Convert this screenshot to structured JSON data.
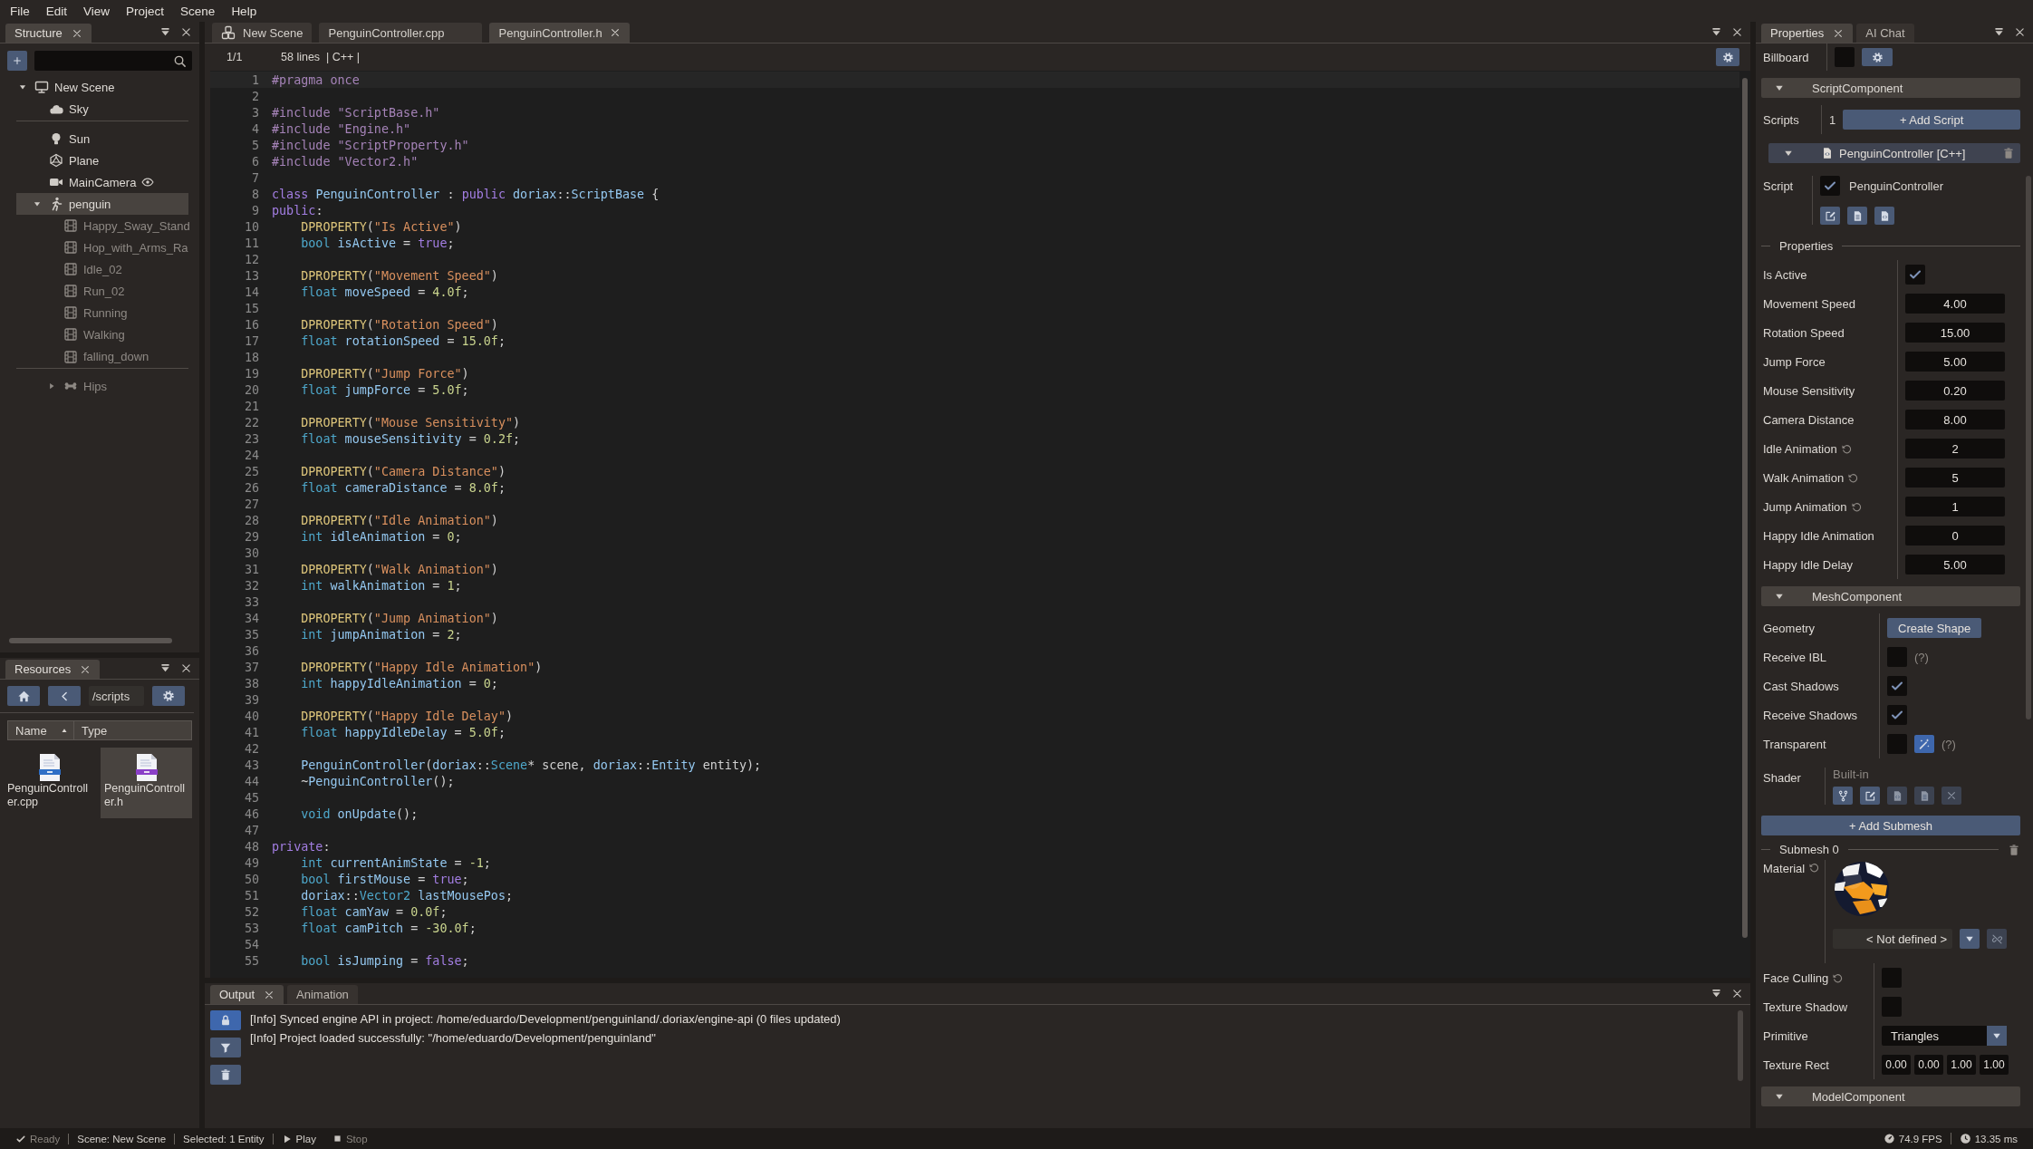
{
  "menu": [
    "File",
    "Edit",
    "View",
    "Project",
    "Scene",
    "Help"
  ],
  "structure": {
    "tabs": [
      {
        "label": "Structure",
        "selected": true
      }
    ],
    "tree": [
      {
        "label": "New Scene",
        "kind": "scene",
        "expanded": true,
        "selected": false,
        "divider_after": false,
        "children": [
          {
            "label": "Sky",
            "kind": "sky",
            "selected": false,
            "divider_after": true
          },
          {
            "label": "Sun",
            "kind": "light",
            "selected": false,
            "divider_after": false
          },
          {
            "label": "Plane",
            "kind": "mesh",
            "selected": false,
            "divider_after": false
          },
          {
            "label": "MainCamera",
            "kind": "camera",
            "selected": false,
            "divider_after": false
          },
          {
            "label": "penguin",
            "kind": "model",
            "expanded": true,
            "selected": true,
            "divider_after": false,
            "children": [
              {
                "label": "Happy_Sway_Stand",
                "kind": "animation",
                "selected": false,
                "divider_after": false
              },
              {
                "label": "Hop_with_Arms_Ra",
                "kind": "animation",
                "selected": false,
                "divider_after": false
              },
              {
                "label": "Idle_02",
                "kind": "animation",
                "selected": false,
                "divider_after": false
              },
              {
                "label": "Run_02",
                "kind": "animation",
                "selected": false,
                "divider_after": false
              },
              {
                "label": "Running",
                "kind": "animation",
                "selected": false,
                "divider_after": false
              },
              {
                "label": "Walking",
                "kind": "animation",
                "selected": false,
                "divider_after": false
              },
              {
                "label": "falling_down",
                "kind": "animation",
                "selected": false,
                "divider_after": true
              },
              {
                "label": "Hips",
                "kind": "bone",
                "expanded": false,
                "selected": false,
                "divider_after": false
              }
            ]
          }
        ]
      }
    ]
  },
  "resources": {
    "tabs": [
      {
        "label": "Resources",
        "selected": true
      }
    ],
    "path": "/scripts",
    "columns": [
      {
        "label": "Name",
        "sorted": true
      },
      {
        "label": "Type",
        "sorted": false
      }
    ],
    "files": [
      {
        "name": "PenguinController.cpp",
        "kind": "cpp",
        "selected": false
      },
      {
        "name": "PenguinController.h",
        "kind": "h",
        "selected": true
      }
    ]
  },
  "editor": {
    "tabs": [
      {
        "label": "New Scene",
        "kind": "scene",
        "selected": false
      },
      {
        "label": "PenguinController.cpp",
        "kind": "file",
        "selected": false
      },
      {
        "label": "PenguinController.h",
        "kind": "file",
        "selected": true
      }
    ],
    "position": "1/1",
    "info": "58 lines  | C++ |",
    "lines": [
      {
        "number": "1",
        "indent": false,
        "tokens": [
          {
            "kind": "pre",
            "text": "#pragma once"
          }
        ]
      },
      {
        "number": "2"
      },
      {
        "number": "3",
        "indent": false,
        "tokens": [
          {
            "kind": "pre",
            "text": "#include \"ScriptBase.h\""
          }
        ]
      },
      {
        "number": "4",
        "indent": false,
        "tokens": [
          {
            "kind": "pre",
            "text": "#include \"Engine.h\""
          }
        ]
      },
      {
        "number": "5",
        "indent": false,
        "tokens": [
          {
            "kind": "pre",
            "text": "#include \"ScriptProperty.h\""
          }
        ]
      },
      {
        "number": "6",
        "indent": false,
        "tokens": [
          {
            "kind": "pre",
            "text": "#include \"Vector2.h\""
          }
        ]
      },
      {
        "number": "7"
      },
      {
        "number": "8",
        "indent": false,
        "tokens": [
          {
            "kind": "kw",
            "text": "class "
          },
          {
            "kind": "id",
            "text": "PenguinController"
          },
          {
            "kind": "p",
            "text": " : "
          },
          {
            "kind": "kw",
            "text": "public "
          },
          {
            "kind": "id",
            "text": "doriax"
          },
          {
            "kind": "p",
            "text": "::"
          },
          {
            "kind": "id",
            "text": "ScriptBase"
          },
          {
            "kind": "p",
            "text": " {"
          }
        ]
      },
      {
        "number": "9",
        "indent": false,
        "tokens": [
          {
            "kind": "kw",
            "text": "public"
          },
          {
            "kind": "p",
            "text": ":"
          }
        ]
      },
      {
        "number": "10",
        "indent": true,
        "tokens": [
          {
            "kind": "fn",
            "text": "DPROPERTY"
          },
          {
            "kind": "p",
            "text": "("
          },
          {
            "kind": "str",
            "text": "\"Is Active\""
          },
          {
            "kind": "p",
            "text": ")"
          }
        ]
      },
      {
        "number": "11",
        "indent": true,
        "tokens": [
          {
            "kind": "type",
            "text": "bool "
          },
          {
            "kind": "id",
            "text": "isActive"
          },
          {
            "kind": "p",
            "text": " = "
          },
          {
            "kind": "kw",
            "text": "true"
          },
          {
            "kind": "p",
            "text": ";"
          }
        ]
      },
      {
        "number": "12"
      },
      {
        "number": "13",
        "indent": true,
        "tokens": [
          {
            "kind": "fn",
            "text": "DPROPERTY"
          },
          {
            "kind": "p",
            "text": "("
          },
          {
            "kind": "str",
            "text": "\"Movement Speed\""
          },
          {
            "kind": "p",
            "text": ")"
          }
        ]
      },
      {
        "number": "14",
        "indent": true,
        "tokens": [
          {
            "kind": "type",
            "text": "float "
          },
          {
            "kind": "id",
            "text": "moveSpeed"
          },
          {
            "kind": "p",
            "text": " = "
          },
          {
            "kind": "num",
            "text": "4.0f"
          },
          {
            "kind": "p",
            "text": ";"
          }
        ]
      },
      {
        "number": "15"
      },
      {
        "number": "16",
        "indent": true,
        "tokens": [
          {
            "kind": "fn",
            "text": "DPROPERTY"
          },
          {
            "kind": "p",
            "text": "("
          },
          {
            "kind": "str",
            "text": "\"Rotation Speed\""
          },
          {
            "kind": "p",
            "text": ")"
          }
        ]
      },
      {
        "number": "17",
        "indent": true,
        "tokens": [
          {
            "kind": "type",
            "text": "float "
          },
          {
            "kind": "id",
            "text": "rotationSpeed"
          },
          {
            "kind": "p",
            "text": " = "
          },
          {
            "kind": "num",
            "text": "15.0f"
          },
          {
            "kind": "p",
            "text": ";"
          }
        ]
      },
      {
        "number": "18"
      },
      {
        "number": "19",
        "indent": true,
        "tokens": [
          {
            "kind": "fn",
            "text": "DPROPERTY"
          },
          {
            "kind": "p",
            "text": "("
          },
          {
            "kind": "str",
            "text": "\"Jump Force\""
          },
          {
            "kind": "p",
            "text": ")"
          }
        ]
      },
      {
        "number": "20",
        "indent": true,
        "tokens": [
          {
            "kind": "type",
            "text": "float "
          },
          {
            "kind": "id",
            "text": "jumpForce"
          },
          {
            "kind": "p",
            "text": " = "
          },
          {
            "kind": "num",
            "text": "5.0f"
          },
          {
            "kind": "p",
            "text": ";"
          }
        ]
      },
      {
        "number": "21"
      },
      {
        "number": "22",
        "indent": true,
        "tokens": [
          {
            "kind": "fn",
            "text": "DPROPERTY"
          },
          {
            "kind": "p",
            "text": "("
          },
          {
            "kind": "str",
            "text": "\"Mouse Sensitivity\""
          },
          {
            "kind": "p",
            "text": ")"
          }
        ]
      },
      {
        "number": "23",
        "indent": true,
        "tokens": [
          {
            "kind": "type",
            "text": "float "
          },
          {
            "kind": "id",
            "text": "mouseSensitivity"
          },
          {
            "kind": "p",
            "text": " = "
          },
          {
            "kind": "num",
            "text": "0.2f"
          },
          {
            "kind": "p",
            "text": ";"
          }
        ]
      },
      {
        "number": "24"
      },
      {
        "number": "25",
        "indent": true,
        "tokens": [
          {
            "kind": "fn",
            "text": "DPROPERTY"
          },
          {
            "kind": "p",
            "text": "("
          },
          {
            "kind": "str",
            "text": "\"Camera Distance\""
          },
          {
            "kind": "p",
            "text": ")"
          }
        ]
      },
      {
        "number": "26",
        "indent": true,
        "tokens": [
          {
            "kind": "type",
            "text": "float "
          },
          {
            "kind": "id",
            "text": "cameraDistance"
          },
          {
            "kind": "p",
            "text": " = "
          },
          {
            "kind": "num",
            "text": "8.0f"
          },
          {
            "kind": "p",
            "text": ";"
          }
        ]
      },
      {
        "number": "27"
      },
      {
        "number": "28",
        "indent": true,
        "tokens": [
          {
            "kind": "fn",
            "text": "DPROPERTY"
          },
          {
            "kind": "p",
            "text": "("
          },
          {
            "kind": "str",
            "text": "\"Idle Animation\""
          },
          {
            "kind": "p",
            "text": ")"
          }
        ]
      },
      {
        "number": "29",
        "indent": true,
        "tokens": [
          {
            "kind": "type",
            "text": "int "
          },
          {
            "kind": "id",
            "text": "idleAnimation"
          },
          {
            "kind": "p",
            "text": " = "
          },
          {
            "kind": "num",
            "text": "0"
          },
          {
            "kind": "p",
            "text": ";"
          }
        ]
      },
      {
        "number": "30"
      },
      {
        "number": "31",
        "indent": true,
        "tokens": [
          {
            "kind": "fn",
            "text": "DPROPERTY"
          },
          {
            "kind": "p",
            "text": "("
          },
          {
            "kind": "str",
            "text": "\"Walk Animation\""
          },
          {
            "kind": "p",
            "text": ")"
          }
        ]
      },
      {
        "number": "32",
        "indent": true,
        "tokens": [
          {
            "kind": "type",
            "text": "int "
          },
          {
            "kind": "id",
            "text": "walkAnimation"
          },
          {
            "kind": "p",
            "text": " = "
          },
          {
            "kind": "num",
            "text": "1"
          },
          {
            "kind": "p",
            "text": ";"
          }
        ]
      },
      {
        "number": "33"
      },
      {
        "number": "34",
        "indent": true,
        "tokens": [
          {
            "kind": "fn",
            "text": "DPROPERTY"
          },
          {
            "kind": "p",
            "text": "("
          },
          {
            "kind": "str",
            "text": "\"Jump Animation\""
          },
          {
            "kind": "p",
            "text": ")"
          }
        ]
      },
      {
        "number": "35",
        "indent": true,
        "tokens": [
          {
            "kind": "type",
            "text": "int "
          },
          {
            "kind": "id",
            "text": "jumpAnimation"
          },
          {
            "kind": "p",
            "text": " = "
          },
          {
            "kind": "num",
            "text": "2"
          },
          {
            "kind": "p",
            "text": ";"
          }
        ]
      },
      {
        "number": "36"
      },
      {
        "number": "37",
        "indent": true,
        "tokens": [
          {
            "kind": "fn",
            "text": "DPROPERTY"
          },
          {
            "kind": "p",
            "text": "("
          },
          {
            "kind": "str",
            "text": "\"Happy Idle Animation\""
          },
          {
            "kind": "p",
            "text": ")"
          }
        ]
      },
      {
        "number": "38",
        "indent": true,
        "tokens": [
          {
            "kind": "type",
            "text": "int "
          },
          {
            "kind": "id",
            "text": "happyIdleAnimation"
          },
          {
            "kind": "p",
            "text": " = "
          },
          {
            "kind": "num",
            "text": "0"
          },
          {
            "kind": "p",
            "text": ";"
          }
        ]
      },
      {
        "number": "39"
      },
      {
        "number": "40",
        "indent": true,
        "tokens": [
          {
            "kind": "fn",
            "text": "DPROPERTY"
          },
          {
            "kind": "p",
            "text": "("
          },
          {
            "kind": "str",
            "text": "\"Happy Idle Delay\""
          },
          {
            "kind": "p",
            "text": ")"
          }
        ]
      },
      {
        "number": "41",
        "indent": true,
        "tokens": [
          {
            "kind": "type",
            "text": "float "
          },
          {
            "kind": "id",
            "text": "happyIdleDelay"
          },
          {
            "kind": "p",
            "text": " = "
          },
          {
            "kind": "num",
            "text": "5.0f"
          },
          {
            "kind": "p",
            "text": ";"
          }
        ]
      },
      {
        "number": "42"
      },
      {
        "number": "43",
        "indent": true,
        "tokens": [
          {
            "kind": "id",
            "text": "PenguinController"
          },
          {
            "kind": "p",
            "text": "("
          },
          {
            "kind": "id",
            "text": "doriax"
          },
          {
            "kind": "p",
            "text": "::"
          },
          {
            "kind": "type",
            "text": "Scene"
          },
          {
            "kind": "p",
            "text": "* scene, "
          },
          {
            "kind": "id",
            "text": "doriax"
          },
          {
            "kind": "p",
            "text": "::"
          },
          {
            "kind": "id",
            "text": "Entity"
          },
          {
            "kind": "p",
            "text": " entity);"
          }
        ]
      },
      {
        "number": "44",
        "indent": true,
        "tokens": [
          {
            "kind": "p",
            "text": "~"
          },
          {
            "kind": "id",
            "text": "PenguinController"
          },
          {
            "kind": "p",
            "text": "();"
          }
        ]
      },
      {
        "number": "45"
      },
      {
        "number": "46",
        "indent": true,
        "tokens": [
          {
            "kind": "type",
            "text": "void "
          },
          {
            "kind": "id",
            "text": "onUpdate"
          },
          {
            "kind": "p",
            "text": "();"
          }
        ]
      },
      {
        "number": "47"
      },
      {
        "number": "48",
        "indent": false,
        "tokens": [
          {
            "kind": "kw",
            "text": "private"
          },
          {
            "kind": "p",
            "text": ":"
          }
        ]
      },
      {
        "number": "49",
        "indent": true,
        "tokens": [
          {
            "kind": "type",
            "text": "int "
          },
          {
            "kind": "id",
            "text": "currentAnimState"
          },
          {
            "kind": "p",
            "text": " = "
          },
          {
            "kind": "num",
            "text": "-1"
          },
          {
            "kind": "p",
            "text": ";"
          }
        ]
      },
      {
        "number": "50",
        "indent": true,
        "tokens": [
          {
            "kind": "type",
            "text": "bool "
          },
          {
            "kind": "id",
            "text": "firstMouse"
          },
          {
            "kind": "p",
            "text": " = "
          },
          {
            "kind": "kw",
            "text": "true"
          },
          {
            "kind": "p",
            "text": ";"
          }
        ]
      },
      {
        "number": "51",
        "indent": true,
        "tokens": [
          {
            "kind": "id",
            "text": "doriax"
          },
          {
            "kind": "p",
            "text": "::"
          },
          {
            "kind": "type",
            "text": "Vector2 "
          },
          {
            "kind": "id",
            "text": "lastMousePos"
          },
          {
            "kind": "p",
            "text": ";"
          }
        ]
      },
      {
        "number": "52",
        "indent": true,
        "tokens": [
          {
            "kind": "type",
            "text": "float "
          },
          {
            "kind": "id",
            "text": "camYaw"
          },
          {
            "kind": "p",
            "text": " = "
          },
          {
            "kind": "num",
            "text": "0.0f"
          },
          {
            "kind": "p",
            "text": ";"
          }
        ]
      },
      {
        "number": "53",
        "indent": true,
        "tokens": [
          {
            "kind": "type",
            "text": "float "
          },
          {
            "kind": "id",
            "text": "camPitch"
          },
          {
            "kind": "p",
            "text": " = "
          },
          {
            "kind": "num",
            "text": "-30.0f"
          },
          {
            "kind": "p",
            "text": ";"
          }
        ]
      },
      {
        "number": "54"
      },
      {
        "number": "55",
        "indent": true,
        "tokens": [
          {
            "kind": "type",
            "text": "bool "
          },
          {
            "kind": "id",
            "text": "isJumping"
          },
          {
            "kind": "p",
            "text": " = "
          },
          {
            "kind": "kw",
            "text": "false"
          },
          {
            "kind": "p",
            "text": ";"
          }
        ]
      }
    ]
  },
  "output": {
    "tabs": [
      {
        "label": "Output",
        "selected": true
      },
      {
        "label": "Animation",
        "selected": false
      }
    ],
    "lock_on": true,
    "messages": [
      "[Info] Synced engine API in project: /home/eduardo/Development/penguinland/.doriax/engine-api (0 files updated)",
      "[Info] Project loaded successfully: \"/home/eduardo/Development/penguinland\""
    ]
  },
  "properties_panel": {
    "tabs": [
      {
        "label": "Properties",
        "selected": true
      },
      {
        "label": "AI Chat",
        "selected": false
      }
    ],
    "billboard": {
      "label": "Billboard",
      "checked": false
    },
    "script_component": {
      "title": "ScriptComponent",
      "expanded": true,
      "scripts_label": "Scripts",
      "script_count": "1",
      "add_button": "+ Add Script",
      "script": {
        "title": "PenguinController [C++]",
        "expanded": true,
        "label": "Script",
        "enabled": true,
        "name": "PenguinController"
      },
      "section": "Properties",
      "fields": [
        {
          "label": "Is Active",
          "kind": "checkbox",
          "checked": true,
          "resettable": false
        },
        {
          "label": "Movement Speed",
          "kind": "number",
          "value": "4.00",
          "resettable": false
        },
        {
          "label": "Rotation Speed",
          "kind": "number",
          "value": "15.00",
          "resettable": false
        },
        {
          "label": "Jump Force",
          "kind": "number",
          "value": "5.00",
          "resettable": false
        },
        {
          "label": "Mouse Sensitivity",
          "kind": "number",
          "value": "0.20",
          "resettable": false
        },
        {
          "label": "Camera Distance",
          "kind": "number",
          "value": "8.00",
          "resettable": false
        },
        {
          "label": "Idle Animation",
          "kind": "number",
          "value": "2",
          "resettable": true
        },
        {
          "label": "Walk Animation",
          "kind": "number",
          "value": "5",
          "resettable": true
        },
        {
          "label": "Jump Animation",
          "kind": "number",
          "value": "1",
          "resettable": true
        },
        {
          "label": "Happy Idle Animation",
          "kind": "number",
          "value": "0",
          "resettable": false
        },
        {
          "label": "Happy Idle Delay",
          "kind": "number",
          "value": "5.00",
          "resettable": false
        }
      ]
    },
    "mesh_component": {
      "title": "MeshComponent",
      "expanded": true,
      "rows": [
        {
          "label": "Geometry",
          "kind": "button",
          "button": "Create Shape"
        },
        {
          "label": "Receive IBL",
          "kind": "checkbox",
          "checked": false,
          "help": "(?)"
        },
        {
          "label": "Cast Shadows",
          "kind": "checkbox",
          "checked": true
        },
        {
          "label": "Receive Shadows",
          "kind": "checkbox",
          "checked": true
        },
        {
          "label": "Transparent",
          "kind": "checkbox_tool",
          "checked": false,
          "help": "(?)"
        }
      ],
      "shader": {
        "label": "Shader",
        "value": "Built-in"
      },
      "add_button": "+ Add Submesh",
      "submesh": {
        "title": "Submesh 0",
        "material_label": "Material",
        "material": "< Not defined >"
      },
      "options": [
        {
          "label": "Face Culling",
          "kind": "checkbox",
          "checked": false,
          "resettable": true
        },
        {
          "label": "Texture Shadow",
          "kind": "checkbox",
          "checked": false,
          "resettable": false
        },
        {
          "label": "Primitive",
          "kind": "select",
          "value": "Triangles",
          "resettable": false
        },
        {
          "label": "Texture Rect",
          "kind": "vector",
          "values": [
            "0.00",
            "0.00",
            "1.00",
            "1.00"
          ],
          "resettable": false
        }
      ]
    },
    "model_component": {
      "title": "ModelComponent",
      "expanded": true
    }
  },
  "status_bar": {
    "ready": "Ready",
    "scene": "Scene: New Scene",
    "selection": "Selected: 1 Entity",
    "play": "Play",
    "stop": "Stop",
    "stop_disabled": true,
    "fps": "74.9 FPS",
    "frame_time": "13.35 ms"
  }
}
